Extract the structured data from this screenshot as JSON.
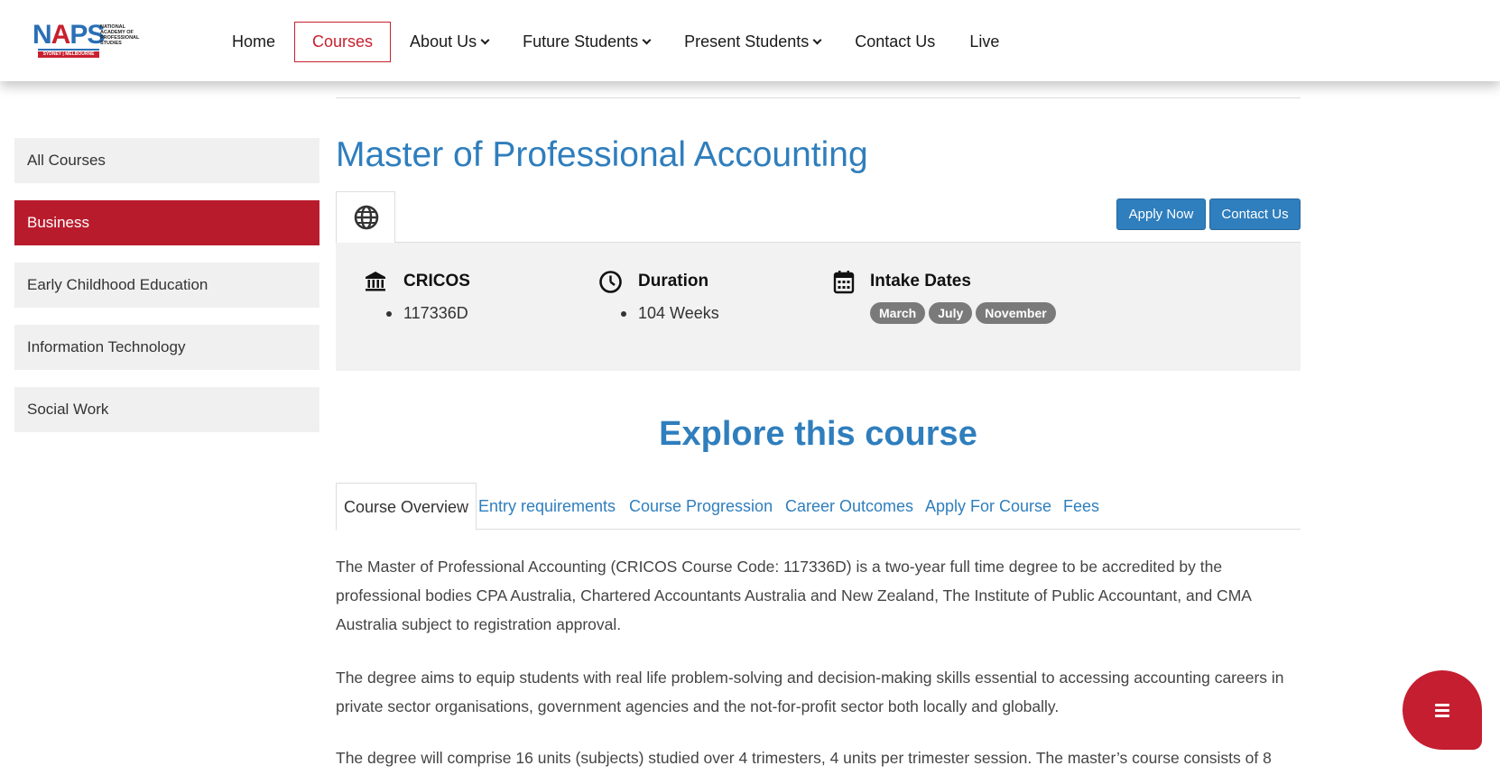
{
  "logo": {
    "mark_n": "N",
    "mark_a": "A",
    "mark_ps": "PS",
    "subtitle": "NATIONAL ACADEMY OF PROFESSIONAL STUDIES",
    "locations": "SYDNEY | MELBOURNE"
  },
  "nav": {
    "items": [
      {
        "label": "Home",
        "active": false,
        "dropdown": false
      },
      {
        "label": "Courses",
        "active": true,
        "dropdown": false
      },
      {
        "label": "About Us",
        "active": false,
        "dropdown": true
      },
      {
        "label": "Future Students",
        "active": false,
        "dropdown": true
      },
      {
        "label": "Present Students",
        "active": false,
        "dropdown": true
      },
      {
        "label": "Contact Us",
        "active": false,
        "dropdown": false
      },
      {
        "label": "Live",
        "active": false,
        "dropdown": false
      }
    ]
  },
  "sidebar": {
    "items": [
      {
        "label": "All Courses",
        "active": false
      },
      {
        "label": "Business",
        "active": true
      },
      {
        "label": "Early Childhood Education",
        "active": false
      },
      {
        "label": "Information Technology",
        "active": false
      },
      {
        "label": "Social Work",
        "active": false
      }
    ]
  },
  "course": {
    "title": "Master of Professional Accounting",
    "apply_label": "Apply Now",
    "contact_label": "Contact Us",
    "info": {
      "cricos_label": "CRICOS",
      "cricos_value": "117336D",
      "duration_label": "Duration",
      "duration_value": "104 Weeks",
      "intake_label": "Intake Dates",
      "intakes": [
        "March",
        "July",
        "November"
      ]
    }
  },
  "explore": {
    "heading": "Explore this course",
    "tabs": [
      {
        "label": "Course Overview",
        "active": true
      },
      {
        "label": "Entry requirements",
        "active": false
      },
      {
        "label": "Course Progression",
        "active": false
      },
      {
        "label": "Career Outcomes",
        "active": false
      },
      {
        "label": "Apply For Course",
        "active": false
      },
      {
        "label": "Fees",
        "active": false
      }
    ],
    "paragraphs": [
      "The Master of Professional Accounting (CRICOS Course Code: 117336D) is a two-year full time degree to be accredited by the professional bodies CPA Australia, Chartered Accountants Australia and New Zealand, The Institute of Public Accountant, and CMA Australia subject to registration approval.",
      "The degree aims to equip students with real life problem-solving and decision-making skills essential to accessing accounting careers in private sector organisations, government agencies and the not-for-profit sector both locally and globally.",
      "The degree will comprise 16 units (subjects) studied over 4 trimesters, 4 units per trimester session. The master’s course consists of 8"
    ]
  },
  "colors": {
    "brand_blue": "#2f7ebd",
    "brand_red": "#b81c2c",
    "pill_gray": "#7a7a7a"
  },
  "icons": {
    "globe": "globe-icon",
    "cricos": "bank-icon",
    "duration": "clock-icon",
    "intake": "calendar-icon",
    "fab": "menu-icon"
  }
}
